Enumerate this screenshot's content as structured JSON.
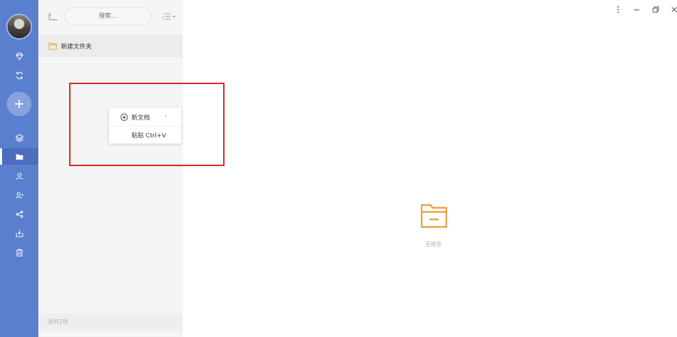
{
  "sidebar": {
    "avatar_icon": "user-avatar",
    "nav": [
      {
        "name": "diamond-icon"
      },
      {
        "name": "sync-icon"
      },
      {
        "name": "layers-icon"
      },
      {
        "name": "folder-icon",
        "active": true
      },
      {
        "name": "contacts-icon"
      },
      {
        "name": "user-group-icon"
      },
      {
        "name": "share-icon"
      },
      {
        "name": "inbox-icon"
      },
      {
        "name": "trash-icon"
      }
    ],
    "add_icon": "plus-icon"
  },
  "file_panel": {
    "search_placeholder": "搜索...",
    "items": [
      {
        "icon": "folder-icon",
        "label": "新建文件夹"
      }
    ],
    "footer": "总共1项"
  },
  "context_menu": {
    "items": [
      {
        "icon": "plus-circle-icon",
        "label": "新文档",
        "submenu": "›"
      },
      {
        "label": "粘贴 Ctrl+V"
      }
    ]
  },
  "preview": {
    "empty_text": "无预览",
    "icon": "folder-icon"
  },
  "window_controls": [
    "more-vertical-icon",
    "minimize-icon",
    "restore-icon",
    "close-icon"
  ],
  "colors": {
    "rail": "#5a7fcf",
    "panel": "#f5f5f5",
    "accent_folder": "#e8a33d",
    "highlight_box": "#e02020"
  }
}
